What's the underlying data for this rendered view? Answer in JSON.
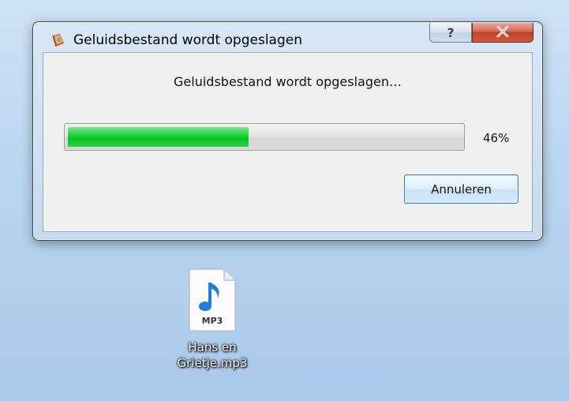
{
  "window": {
    "title": "Geluidsbestand wordt opgeslagen",
    "help_label": "?",
    "close_label": "X"
  },
  "dialog": {
    "message": "Geluidsbestand wordt opgeslagen…",
    "progress_fraction": 0.46,
    "percent_text": "46%",
    "cancel_label": "Annuleren"
  },
  "desktop": {
    "file_icon_badge": "MP3",
    "file_name_line1": "Hans en",
    "file_name_line2": "Grietje.mp3"
  },
  "colors": {
    "progress_fill": "#08c524",
    "close_button": "#c0412b"
  },
  "icons": [
    "app-icon",
    "help-icon",
    "close-icon",
    "mp3-file-icon"
  ]
}
